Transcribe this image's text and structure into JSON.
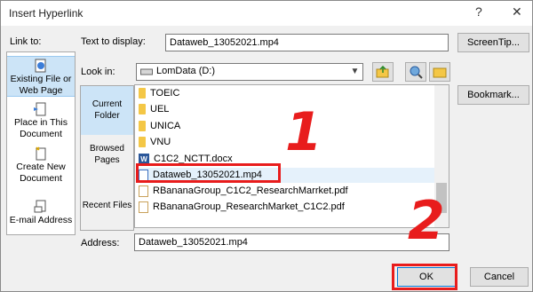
{
  "window": {
    "title": "Insert Hyperlink",
    "help_glyph": "?",
    "close_glyph": "✕"
  },
  "link_to": {
    "label": "Link to:",
    "items": [
      {
        "label": "Existing File or Web Page",
        "icon": "globe-page-icon",
        "selected": true
      },
      {
        "label": "Place in This Document",
        "icon": "document-icon",
        "selected": false
      },
      {
        "label": "Create New Document",
        "icon": "new-document-icon",
        "selected": false
      },
      {
        "label": "E-mail Address",
        "icon": "mail-icon",
        "selected": false
      }
    ]
  },
  "text_to_display": {
    "label": "Text to display:",
    "value": "Dataweb_13052021.mp4"
  },
  "screentip_button": "ScreenTip...",
  "look_in": {
    "label": "Look in:",
    "value": "LomData (D:)",
    "icon": "drive-icon"
  },
  "toolbar": [
    "up-folder-icon",
    "browse-web-icon",
    "browse-file-icon"
  ],
  "bookmark_button": "Bookmark...",
  "nav": [
    {
      "label": "Current Folder",
      "selected": true
    },
    {
      "label": "Browsed Pages",
      "selected": false
    },
    {
      "label": "Recent Files",
      "selected": false
    }
  ],
  "files": [
    {
      "name": "TOEIC",
      "type": "folder"
    },
    {
      "name": "UEL",
      "type": "folder"
    },
    {
      "name": "UNICA",
      "type": "folder"
    },
    {
      "name": "VNU",
      "type": "folder"
    },
    {
      "name": "C1C2_NCTT.docx",
      "type": "word"
    },
    {
      "name": "Dataweb_13052021.mp4",
      "type": "video",
      "selected": true
    },
    {
      "name": "RBananaGroup_C1C2_ResearchMarrket.pdf",
      "type": "pdf"
    },
    {
      "name": "RBananaGroup_ResearchMarket_C1C2.pdf",
      "type": "pdf"
    }
  ],
  "address": {
    "label": "Address:",
    "value": "Dataweb_13052021.mp4"
  },
  "ok_button": "OK",
  "cancel_button": "Cancel",
  "annotations": {
    "step1": "1",
    "step2": "2",
    "color": "#e81c1c"
  },
  "colors": {
    "selection": "#cce4f7",
    "annotation": "#e81c1c"
  }
}
